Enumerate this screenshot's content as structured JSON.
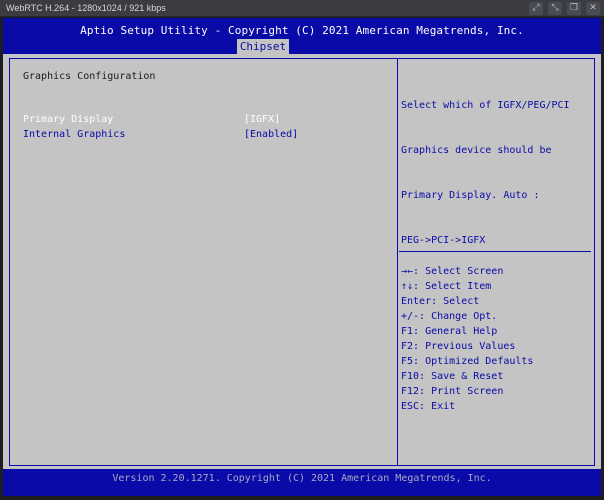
{
  "window": {
    "title": "WebRTC H.264 - 1280x1024 / 921 kbps",
    "icons": [
      "expand-icon",
      "collapse-icon",
      "copy-icon",
      "close-icon"
    ]
  },
  "bios": {
    "header_title": "Aptio Setup Utility - Copyright (C) 2021 American Megatrends, Inc.",
    "active_tab": "Chipset",
    "section_title": "Graphics Configuration",
    "settings": [
      {
        "label": "Primary Display",
        "value": "[IGFX]",
        "selected": true
      },
      {
        "label": "Internal Graphics",
        "value": "[Enabled]",
        "selected": false
      }
    ],
    "help_lines": [
      "Select which of IGFX/PEG/PCI",
      "Graphics device should be",
      "Primary Display. Auto :",
      "PEG->PCI->IGFX"
    ],
    "key_help": [
      "→←: Select Screen",
      "↑↓: Select Item",
      "Enter: Select",
      "+/-: Change Opt.",
      "F1: General Help",
      "F2: Previous Values",
      "F5: Optimized Defaults",
      "F10: Save & Reset",
      "F12: Print Screen",
      "ESC: Exit"
    ],
    "footer": "Version 2.20.1271. Copyright (C) 2021 American Megatrends, Inc.",
    "colors": {
      "bios_blue": "#0a0aa8",
      "bios_gray": "#c4c4c4",
      "highlight": "#ffffff"
    }
  }
}
